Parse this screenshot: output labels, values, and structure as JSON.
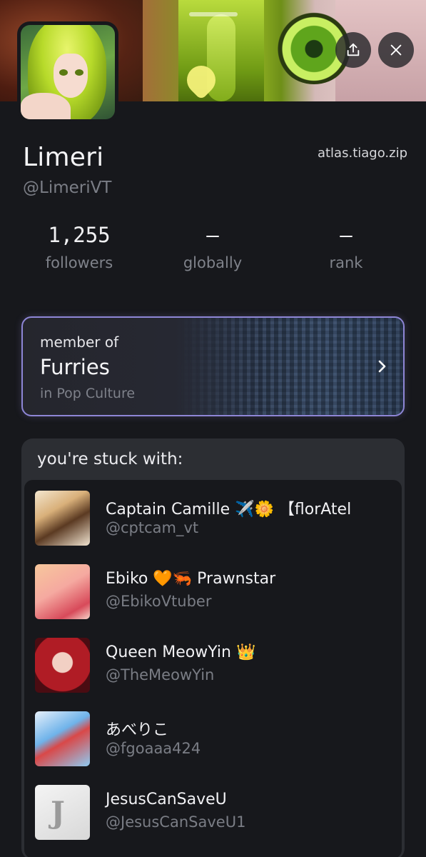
{
  "profile": {
    "name": "Limeri",
    "handle": "@LimeriVT",
    "site": "atlas.tiago.zip"
  },
  "stats": [
    {
      "value": "1,255",
      "label": "followers"
    },
    {
      "value": "—",
      "label": "globally"
    },
    {
      "value": "—",
      "label": "rank"
    }
  ],
  "community": {
    "label": "member of",
    "name": "Furries",
    "sub": "in Pop Culture"
  },
  "stuck": {
    "title": "you're stuck with:",
    "items": [
      {
        "name": "Captain Camille ✈️🌼 【florAtel",
        "handle": "@cptcam_vt"
      },
      {
        "name": "Ebiko 🧡🦐 Prawnstar",
        "handle": "@EbikoVtuber"
      },
      {
        "name": "Queen MeowYin 👑",
        "handle": "@TheMeowYin"
      },
      {
        "name": "あべりこ",
        "handle": "@fgoaaa424"
      },
      {
        "name": "JesusCanSaveU",
        "handle": "@JesusCanSaveU1"
      }
    ]
  },
  "icons": {
    "share": "share-icon",
    "close": "close-icon",
    "chevron": "chevron-right-icon"
  },
  "colors": {
    "background": "#17181c",
    "card_border": "#8e86d6",
    "muted_text": "#7b7e86"
  }
}
